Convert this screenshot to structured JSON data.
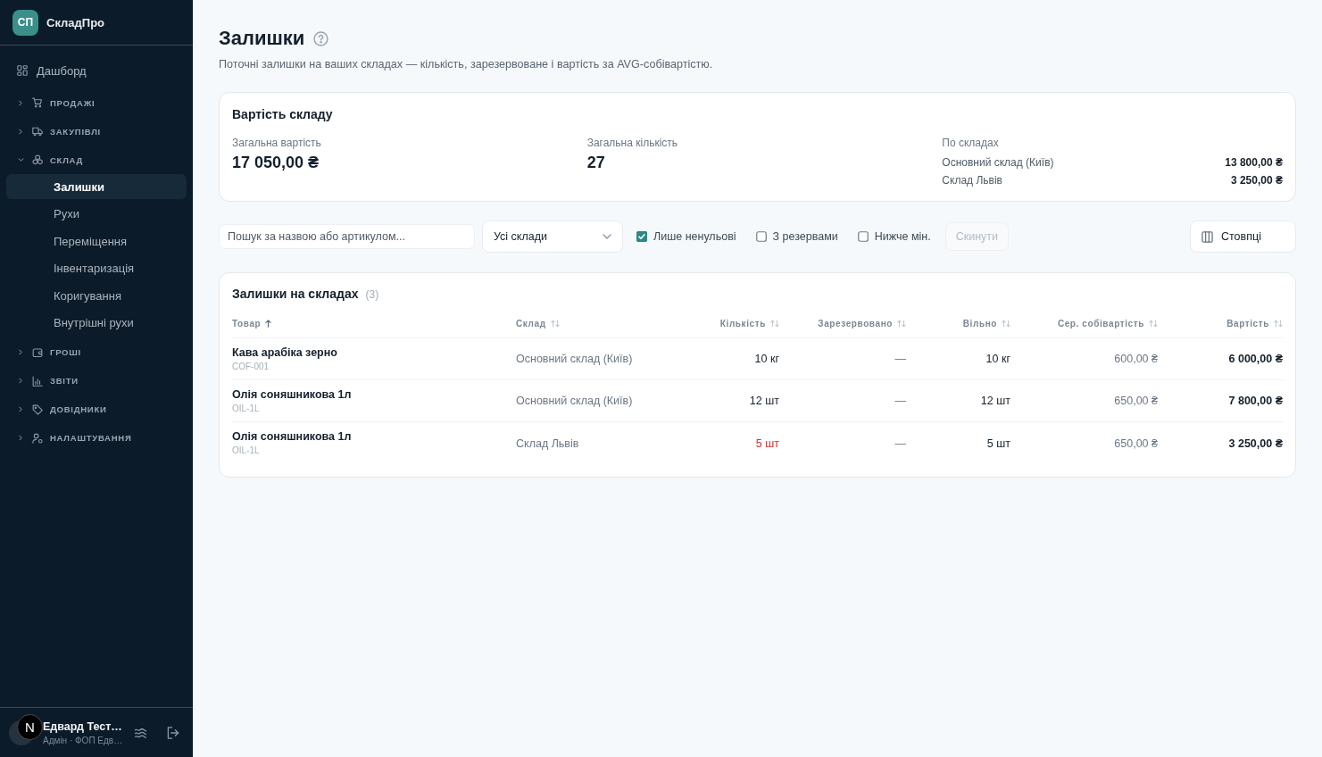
{
  "sidebar": {
    "logo": {
      "badge": "СП",
      "name": "СкладПро"
    },
    "items": [
      {
        "kind": "link",
        "label": "Дашборд",
        "selected": false
      },
      {
        "kind": "group",
        "label": "ПРОДАЖІ",
        "expanded": false
      },
      {
        "kind": "group",
        "label": "ЗАКУПІВЛІ",
        "expanded": false
      },
      {
        "kind": "group",
        "label": "СКЛАД",
        "expanded": true,
        "children": [
          {
            "label": "Залишки",
            "selected": true
          },
          {
            "label": "Рухи",
            "selected": false
          },
          {
            "label": "Переміщення",
            "selected": false
          },
          {
            "label": "Інвентаризація",
            "selected": false
          },
          {
            "label": "Коригування",
            "selected": false
          },
          {
            "label": "Внутрішні рухи",
            "selected": false
          }
        ]
      },
      {
        "kind": "group",
        "label": "ГРОШІ",
        "expanded": false
      },
      {
        "kind": "group",
        "label": "ЗВІТИ",
        "expanded": false
      },
      {
        "kind": "group",
        "label": "ДОВІДНИКИ",
        "expanded": false
      },
      {
        "kind": "group",
        "label": "НАЛАШТУВАННЯ",
        "expanded": false
      }
    ],
    "user": {
      "name": "Едвард Тест…",
      "role": "Адмін · ФОП Едв…"
    },
    "dev_badge": "N"
  },
  "page": {
    "title": "Залишки",
    "subtitle": "Поточні залишки на ваших складах — кількість, зарезервоване і вартість за AVG-собівартістю."
  },
  "summary": {
    "title": "Вартість складу",
    "stats": [
      {
        "label": "Загальна вартість",
        "value": "17 050,00 ₴"
      },
      {
        "label": "Загальна кількість",
        "value": "27"
      }
    ],
    "by_warehouse": {
      "label": "По складах",
      "rows": [
        {
          "name": "Основний склад (Київ)",
          "value": "13 800,00 ₴"
        },
        {
          "name": "Склад Львів",
          "value": "3 250,00 ₴"
        }
      ]
    }
  },
  "filters": {
    "search": {
      "placeholder": "Пошук за назвою або артикулом..."
    },
    "warehouse_select": {
      "value": "Усі склади"
    },
    "checkboxes": [
      {
        "label": "Лише ненульові",
        "checked": true
      },
      {
        "label": "З резервами",
        "checked": false
      },
      {
        "label": "Нижче мін.",
        "checked": false
      }
    ],
    "reset": {
      "label": "Скинути",
      "disabled": true
    },
    "columns_button": {
      "label": "Стовпці"
    }
  },
  "table": {
    "title": "Залишки на складах",
    "count": "(3)",
    "columns": [
      {
        "label": "Товар",
        "sorted": true
      },
      {
        "label": "Склад",
        "sorted": false
      },
      {
        "label": "Кількість",
        "sorted": false
      },
      {
        "label": "Зарезервовано",
        "sorted": false
      },
      {
        "label": "Вільно",
        "sorted": false
      },
      {
        "label": "Сер. собівартість",
        "sorted": false
      },
      {
        "label": "Вартість",
        "sorted": false
      }
    ],
    "rows": [
      {
        "product": "Кава арабіка зерно",
        "sku": "COF-001",
        "warehouse": "Основний склад (Київ)",
        "quantity": "10 кг",
        "low": false,
        "reserved": "—",
        "available": "10 кг",
        "avg_cost": "600,00 ₴",
        "value": "6 000,00 ₴"
      },
      {
        "product": "Олія соняшникова 1л",
        "sku": "OIL-1L",
        "warehouse": "Основний склад (Київ)",
        "quantity": "12 шт",
        "low": false,
        "reserved": "—",
        "available": "12 шт",
        "avg_cost": "650,00 ₴",
        "value": "7 800,00 ₴"
      },
      {
        "product": "Олія соняшникова 1л",
        "sku": "OIL-1L",
        "warehouse": "Склад Львів",
        "quantity": "5 шт",
        "low": true,
        "reserved": "—",
        "available": "5 шт",
        "avg_cost": "650,00 ₴",
        "value": "3 250,00 ₴"
      }
    ]
  }
}
